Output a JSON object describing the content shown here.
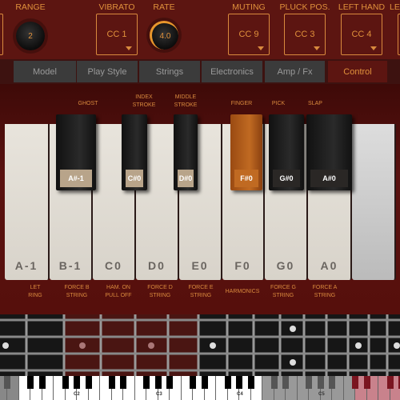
{
  "controls": {
    "range": {
      "label": "RANGE",
      "value": "2"
    },
    "vibrato": {
      "label": "VIBRATO",
      "value": "CC 1"
    },
    "rate": {
      "label": "RATE",
      "value": "4.0"
    },
    "muting": {
      "label": "MUTING",
      "value": "CC 9"
    },
    "pluck_pos": {
      "label": "PLUCK POS.",
      "value": "CC 3"
    },
    "left_hand": {
      "label": "LEFT HAND",
      "value": "CC 4"
    },
    "partial_label": "LE"
  },
  "tabs": [
    {
      "label": "Model"
    },
    {
      "label": "Play Style"
    },
    {
      "label": "Strings"
    },
    {
      "label": "Electronics"
    },
    {
      "label": "Amp / Fx"
    },
    {
      "label": "Control",
      "active": true
    }
  ],
  "top_labels": [
    "GHOST",
    "INDEX\nSTROKE",
    "MIDDLE\nSTROKE",
    "FINGER",
    "PICK",
    "SLAP"
  ],
  "black_keys": [
    "A#-1",
    "C#0",
    "D#0",
    "F#0",
    "G#0",
    "A#0"
  ],
  "selected_black_key": "F#0",
  "white_keys": [
    "A-1",
    "B-1",
    "C0",
    "D0",
    "E0",
    "F0",
    "G0",
    "A0"
  ],
  "bottom_labels": [
    "LET\nRING",
    "FORCE B\nSTRING",
    "HAM. ON\nPULL OFF",
    "FORCE D\nSTRING",
    "FORCE E\nSTRING",
    "HARMONICS",
    "FORCE G\nSTRING",
    "FORCE A\nSTRING"
  ],
  "keyboard_labels": [
    "C2",
    "C3",
    "C4",
    "C5"
  ],
  "colors": {
    "accent": "#e0913c",
    "panel": "#5c1511",
    "selected": "#c06a22"
  }
}
